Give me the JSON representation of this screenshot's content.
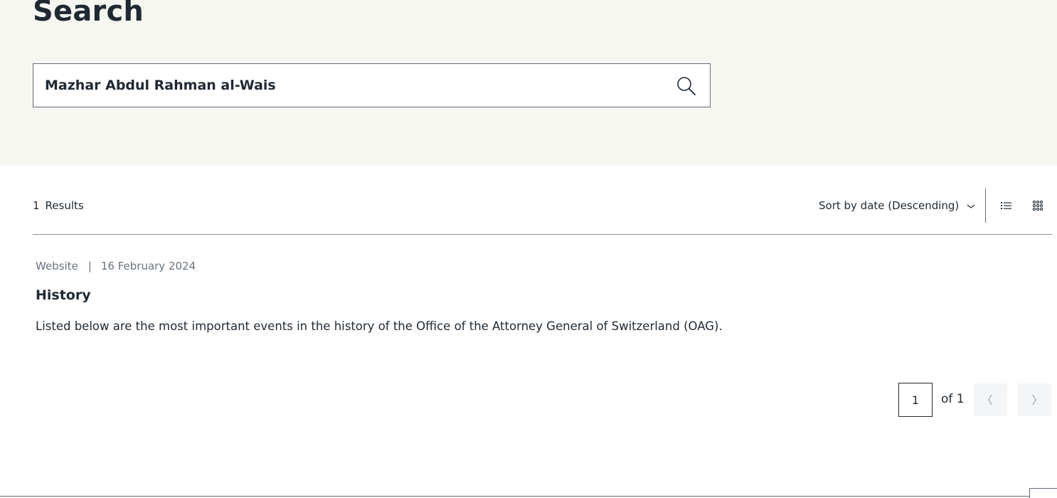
{
  "page": {
    "title": "Search"
  },
  "search": {
    "value": "Mazhar Abdul Rahman al-Wais",
    "icon": "search-icon"
  },
  "results_bar": {
    "count": "1",
    "count_label": "Results",
    "sort_label": "Sort by date (Descending)",
    "sort_icon": "chevron-down-icon",
    "view_icons": [
      "list-view-icon",
      "grid-view-icon"
    ]
  },
  "results": [
    {
      "type": "Website",
      "separator": "|",
      "date": "16 February 2024",
      "title": "History",
      "description": "Listed below are the most important events in the history of the Office of the Attorney General of Switzerland (OAG)."
    }
  ],
  "pagination": {
    "current": "1",
    "of_label": "of 1",
    "prev_icon": "chevron-left-icon",
    "next_icon": "chevron-right-icon"
  },
  "colors": {
    "hero_bg": "#f7f7f2",
    "text": "#1f2933",
    "muted": "#6a737d",
    "pager_bg": "#f4f5f6"
  }
}
